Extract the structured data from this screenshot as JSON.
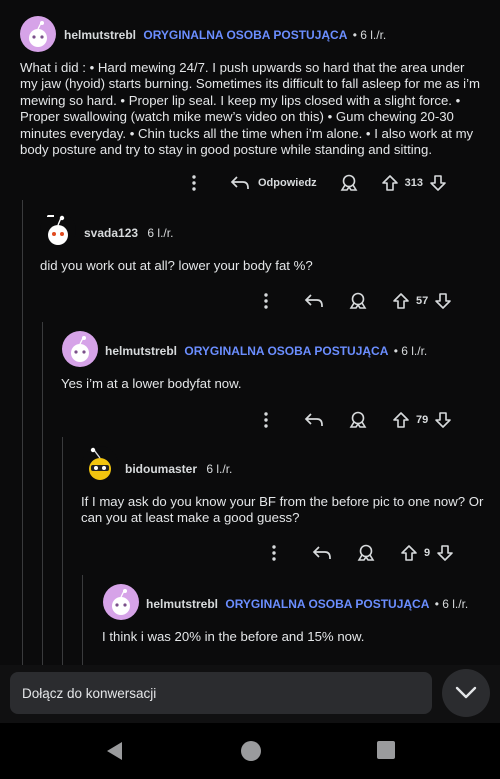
{
  "comments": [
    {
      "username": "helmutstrebl",
      "op_badge": "ORYGINALNA OSOBA POSTUJĄCA",
      "age": "• 6 l./r.",
      "text": "What i did : • Hard mewing 24/7. I push upwards so hard that the area under my jaw (hyoid) starts burning. Sometimes its difficult to fall asleep for me as i’m mewing so hard. • Proper lip seal. I keep my lips closed with a slight force. • Proper swallowing (watch mike mew’s video on this) • Gum chewing 20-30 minutes everyday. • Chin tucks all the time when i’m alone. • I also work at my body posture and try to stay in good posture while standing and sitting.",
      "reply_label": "Odpowiedz",
      "votes": "313",
      "avatar": "snoo-purple"
    },
    {
      "username": "svada123",
      "op_badge": "",
      "age": "6 l./r.",
      "text": "did you work out at all? lower your body fat %?",
      "votes": "57",
      "avatar": "snoo-white"
    },
    {
      "username": "helmutstrebl",
      "op_badge": "ORYGINALNA OSOBA POSTUJĄCA",
      "age": "• 6 l./r.",
      "text": "Yes i’m at a lower bodyfat now.",
      "votes": "79",
      "avatar": "snoo-purple"
    },
    {
      "username": "bidoumaster",
      "op_badge": "",
      "age": "6 l./r.",
      "text": "If I may ask do you know your BF from the before pic to one now? Or can you at least make a good guess?",
      "votes": "9",
      "avatar": "snoo-yellow"
    },
    {
      "username": "helmutstrebl",
      "op_badge": "ORYGINALNA OSOBA POSTUJĄCA",
      "age": "• 6 l./r.",
      "text": "I think i was 20% in the before and 15% now.",
      "votes": "",
      "avatar": "snoo-purple"
    }
  ],
  "join": {
    "placeholder": "Dołącz do konwersacji"
  },
  "icons": {
    "more": "more-vertical-icon",
    "reply": "reply-arrow-icon",
    "award": "award-icon",
    "upvote": "upvote-arrow-icon",
    "downvote": "downvote-arrow-icon",
    "expand": "chevron-down-icon",
    "nav_back": "nav-back-icon",
    "nav_home": "nav-home-icon",
    "nav_recents": "nav-recents-icon"
  },
  "colors": {
    "op_badge": "#6b8eff",
    "background": "#0b0b0c",
    "avatar_purple": "#d6a3e8"
  }
}
